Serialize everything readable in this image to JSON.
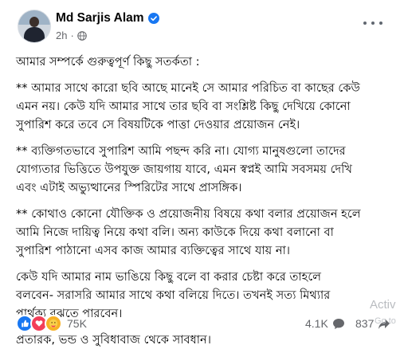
{
  "post": {
    "author": "Md Sarjis Alam",
    "time": "2h",
    "separator": "·",
    "paragraphs": [
      "আমার সম্পর্কে গুরুত্বপূর্ণ কিছু সতর্কতা :",
      "** আমার সাথে কারো ছবি আছে মানেই সে আমার পরিচিত বা কাছের কেউ\nএমন নয়। কেউ যদি আমার সাথে তার ছবি বা সংশ্লিষ্ট কিছু দেখিয়ে কোনো\nসুপারিশ করে তবে সে বিষয়টিকে পাত্তা দেওয়ার প্রয়োজন নেই।",
      "** ব্যক্তিগতভাবে সুপারিশ আমি পছন্দ করি না। যোগ্য মানুষগুলো তাদের\nযোগ্যতার ভিত্তিতে উপযুক্ত জায়গায় যাবে, এমন স্বপ্নই আমি সবসময় দেখি\nএবং এটাই অভ্যুত্থানের স্পিরিটের সাথে প্রাসঙ্গিক।",
      "** কোথাও কোনো যৌক্তিক ও প্রয়োজনীয় বিষয়ে কথা বলার প্রয়োজন হলে\nআমি নিজে দায়িত্ব নিয়ে কথা বলি। অন্য কাউকে দিয়ে কথা বলানো বা\nসুপারিশ পাঠানো এসব কাজ আমার ব্যক্তিত্বের সাথে যায় না।",
      "কেউ যদি আমার নাম ভাঙিয়ে কিছু বলে বা করার চেষ্টা করে তাহলে\nবলবেন- সরাসরি আমার সাথে কথা বলিয়ে দিতে। তখনই সত্য মিথ্যার\nপার্থক্য বুঝতে পারবেন।",
      "প্রতারক, ভন্ড ও সুবিধাবাজ থেকে সাবধান।"
    ]
  },
  "footer": {
    "reaction_count": "75K",
    "comments_count": "4.1K",
    "shares_count": "837"
  },
  "watermark": {
    "line1": "Activ",
    "line2": "Go to"
  },
  "icons": {
    "verified": "verified-badge-icon",
    "privacy": "globe-icon",
    "more": "more-options-icon",
    "comment": "comment-icon",
    "share": "share-icon",
    "reactions": [
      "like-icon",
      "love-icon",
      "care-icon"
    ]
  },
  "colors": {
    "accent": "#1877f2",
    "love": "#f33e58",
    "care": "#f7b125",
    "secondary_text": "#65676b"
  }
}
